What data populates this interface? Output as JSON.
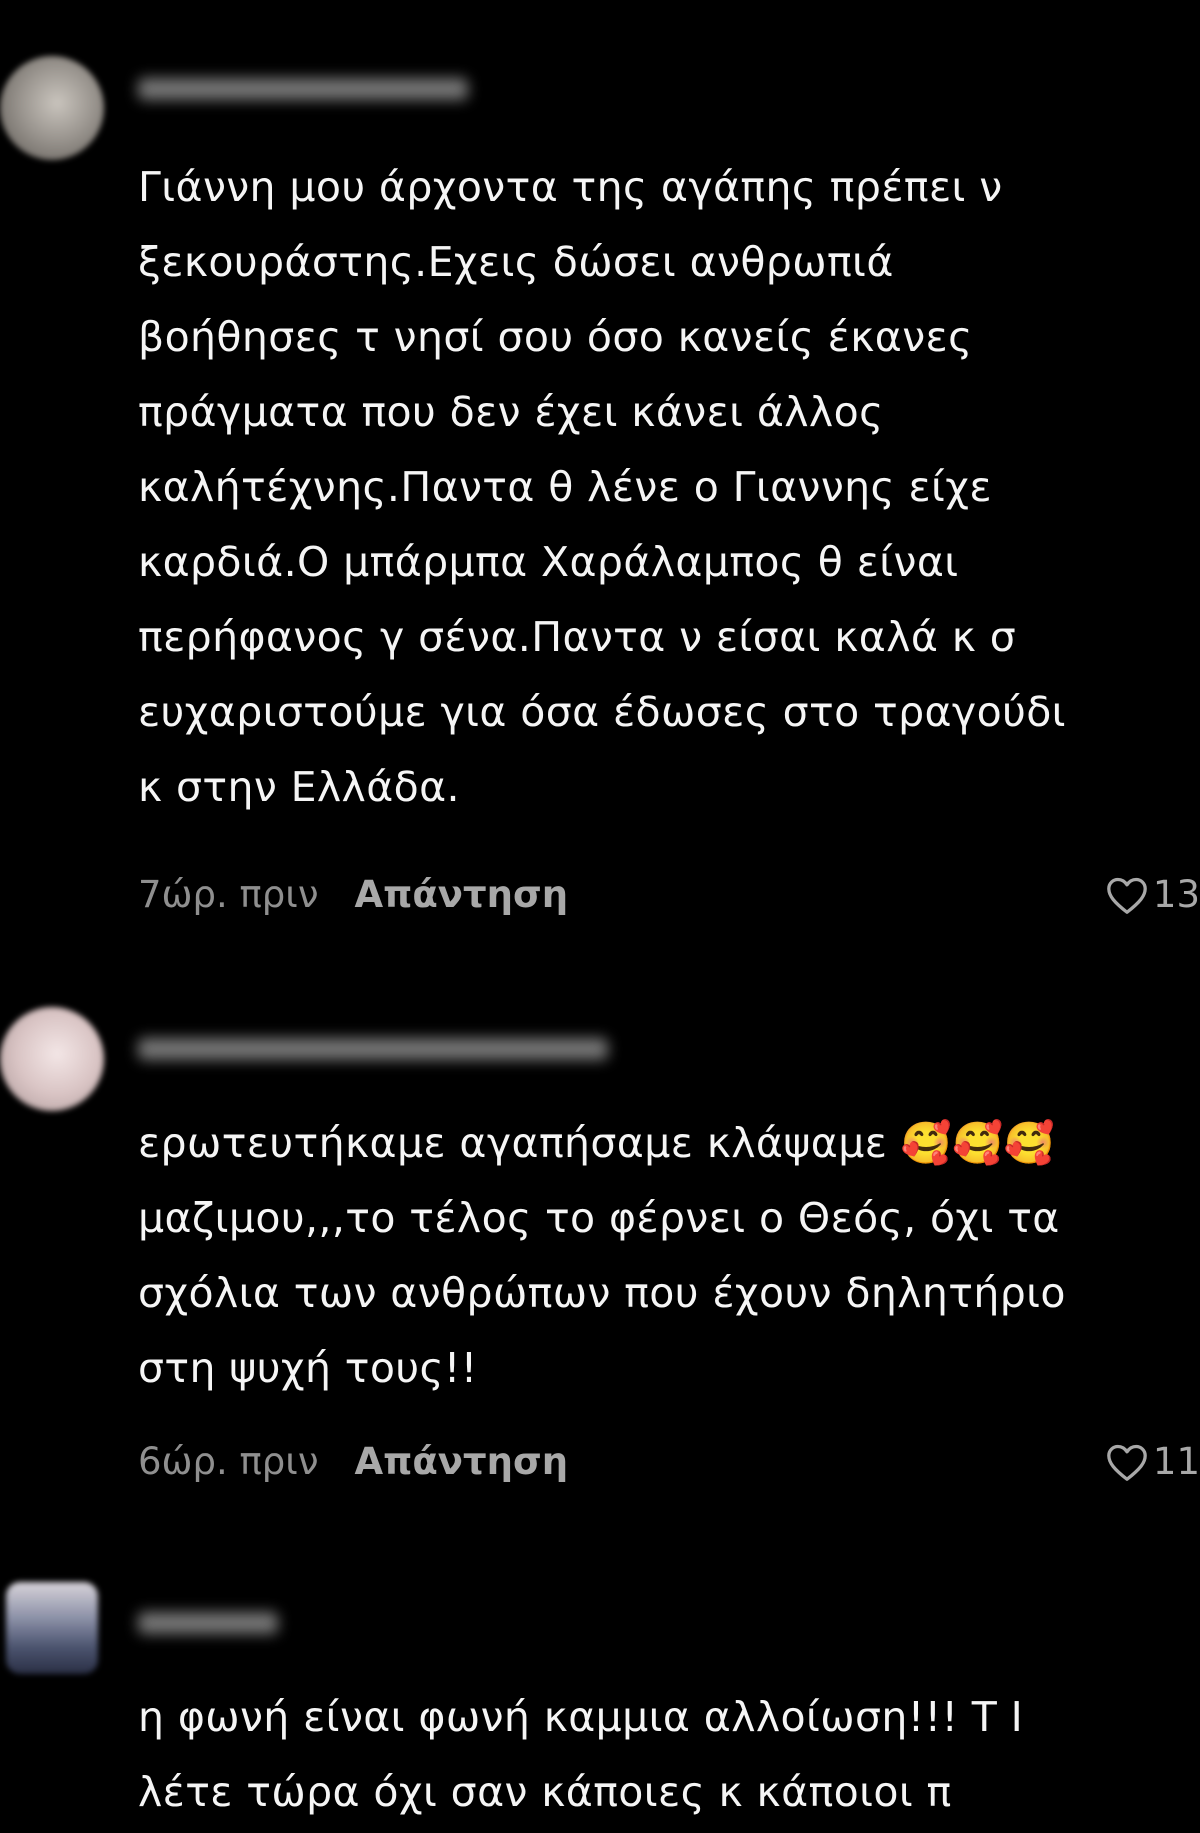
{
  "comments": [
    {
      "username": "6787474553981",
      "text": "Γιάννη μου άρχοντα της αγάπης πρέπει ν\nξεκουράστης.Εχεις δώσει ανθρωπιά\nβοήθησες τ νησί σου όσο κανείς έκανες\nπράγματα που δεν έχει κάνει άλλος\nκαλήτέχνης.Παντα θ λένε ο Γιαννης είχε\nκαρδιά.Ο μπάρμπα Χαράλαμπος θ είναι\nπερήφανος γ σένα.Παντα ν είσαι καλά κ σ\nευχαριστούμε για όσα έδωσες στο τραγούδι\nκ στην Ελλάδα.",
      "time": "7ώρ. πριν",
      "reply_label": "Απάντηση",
      "likes": "13"
    },
    {
      "username": "user2412237810083",
      "text": "ερωτευτήκαμε αγαπήσαμε κλάψαμε 🥰🥰🥰\nμαζιμου,,,το τέλος το φέρνει ο Θεός, όχι τα\nσχόλια των ανθρώπων που έχουν δηλητήριο\nστη ψυχή τους!!",
      "time": "6ώρ. πριν",
      "reply_label": "Απάντηση",
      "likes": "11"
    },
    {
      "username": "chryso",
      "text": "η φωνή είναι φωνή καμμια αλλοίωση!!! Τ Ι\nλέτε τώρα όχι σαν κάποιες κ κάποιοι π",
      "time": "",
      "reply_label": "",
      "likes": ""
    }
  ],
  "icons": {
    "like": "heart-outline-icon"
  },
  "colors": {
    "background": "#000000",
    "text": "#f5f5f5",
    "meta": "#8f8f8f",
    "reply": "#a8a8a8"
  }
}
